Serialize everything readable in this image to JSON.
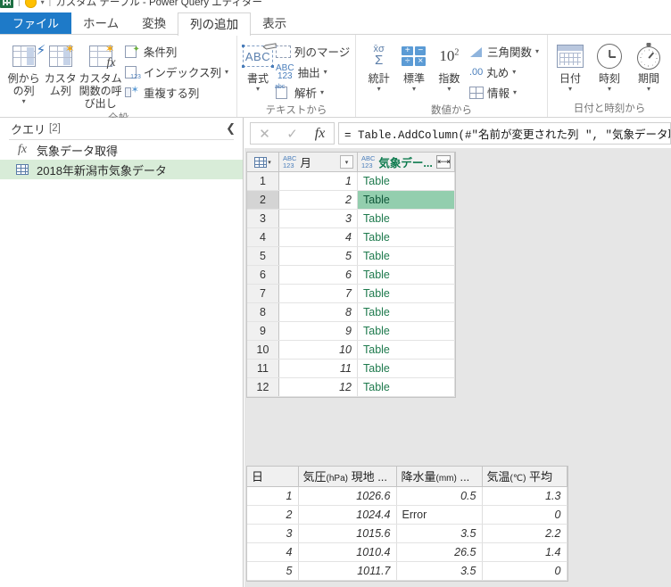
{
  "window": {
    "title": "カスタム テーブル - Power Query エディター",
    "quick_access": [
      "save-icon",
      "undo-icon",
      "redo-icon"
    ]
  },
  "tabs": [
    {
      "label": "ファイル",
      "kind": "file"
    },
    {
      "label": "ホーム",
      "kind": "normal"
    },
    {
      "label": "変換",
      "kind": "normal"
    },
    {
      "label": "列の追加",
      "kind": "active"
    },
    {
      "label": "表示",
      "kind": "normal"
    }
  ],
  "ribbon": {
    "groups": [
      {
        "label": "全般",
        "big": [
          {
            "label": "例からの列",
            "icon": "table-from-example-icon",
            "dropdown": true
          },
          {
            "label": "カスタム列",
            "icon": "table-custom-column-icon",
            "dropdown": false
          },
          {
            "label": "カスタム関数の呼び出し",
            "icon": "table-invoke-function-icon",
            "dropdown": false
          }
        ],
        "small": [
          {
            "label": "条件列",
            "icon": "conditional-column-icon",
            "dropdown": false
          },
          {
            "label": "インデックス列",
            "icon": "index-column-icon",
            "dropdown": true
          },
          {
            "label": "重複する列",
            "icon": "duplicate-column-icon",
            "dropdown": false
          }
        ]
      },
      {
        "label": "テキストから",
        "big": [
          {
            "label": "書式",
            "icon": "format-abc-icon",
            "dropdown": true
          }
        ],
        "small": [
          {
            "label": "列のマージ",
            "icon": "merge-columns-icon",
            "dropdown": false
          },
          {
            "label": "抽出",
            "icon": "extract-icon",
            "dropdown": true
          },
          {
            "label": "解析",
            "icon": "parse-icon",
            "dropdown": true
          }
        ]
      },
      {
        "label": "数値から",
        "big": [
          {
            "label": "統計",
            "icon": "statistics-sigma-icon",
            "dropdown": true
          },
          {
            "label": "標準",
            "icon": "standard-calculator-icon",
            "dropdown": true
          },
          {
            "label": "指数",
            "icon": "exponent-icon",
            "dropdown": true
          }
        ],
        "small": [
          {
            "label": "三角関数",
            "icon": "trigonometry-icon",
            "dropdown": true
          },
          {
            "label": "丸め",
            "icon": "rounding-icon",
            "dropdown": true
          },
          {
            "label": "情報",
            "icon": "information-icon",
            "dropdown": true
          }
        ]
      },
      {
        "label": "日付と時刻から",
        "big": [
          {
            "label": "日付",
            "icon": "calendar-icon",
            "dropdown": true
          },
          {
            "label": "時刻",
            "icon": "clock-icon",
            "dropdown": true
          },
          {
            "label": "期間",
            "icon": "duration-timer-icon",
            "dropdown": true
          }
        ],
        "small": []
      }
    ]
  },
  "queries_pane": {
    "title": "クエリ",
    "count": "[2]",
    "collapse_icon": "chevron-left-icon",
    "items": [
      {
        "label": "気象データ取得",
        "icon": "fx-function-icon",
        "selected": false
      },
      {
        "label": "2018年新潟市気象データ",
        "icon": "table-icon",
        "selected": true
      }
    ]
  },
  "formula_bar": {
    "cancel_icon": "close-icon",
    "confirm_icon": "check-icon",
    "fx_icon": "fx-icon",
    "value": "= Table.AddColumn(#\"名前が変更された列 \", \"気象データ取得\"",
    "placeholder": ""
  },
  "main_grid": {
    "columns": [
      {
        "name": "月",
        "type_badge": "ABC\n123",
        "control": "filter-dropdown",
        "green": false
      },
      {
        "name": "気象デー...",
        "type_badge": "ABC\n123",
        "control": "expand",
        "green": true
      }
    ],
    "rows": [
      {
        "n": "1",
        "month": "1",
        "value": "Table",
        "selected": false
      },
      {
        "n": "2",
        "month": "2",
        "value": "Table",
        "selected": true
      },
      {
        "n": "3",
        "month": "3",
        "value": "Table",
        "selected": false
      },
      {
        "n": "4",
        "month": "4",
        "value": "Table",
        "selected": false
      },
      {
        "n": "5",
        "month": "5",
        "value": "Table",
        "selected": false
      },
      {
        "n": "6",
        "month": "6",
        "value": "Table",
        "selected": false
      },
      {
        "n": "7",
        "month": "7",
        "value": "Table",
        "selected": false
      },
      {
        "n": "8",
        "month": "8",
        "value": "Table",
        "selected": false
      },
      {
        "n": "9",
        "month": "9",
        "value": "Table",
        "selected": false
      },
      {
        "n": "10",
        "month": "10",
        "value": "Table",
        "selected": false
      },
      {
        "n": "11",
        "month": "11",
        "value": "Table",
        "selected": false
      },
      {
        "n": "12",
        "month": "12",
        "value": "Table",
        "selected": false
      }
    ]
  },
  "preview_grid": {
    "columns": [
      "日",
      "気圧(hPa) 現地 ...",
      "降水量(mm) ...",
      "気温(℃) 平均"
    ],
    "rows": [
      {
        "day": "1",
        "pressure": "1026.6",
        "rain": "0.5",
        "temp": "1.3",
        "rain_error": false
      },
      {
        "day": "2",
        "pressure": "1024.4",
        "rain": "Error",
        "temp": "0",
        "rain_error": true
      },
      {
        "day": "3",
        "pressure": "1015.6",
        "rain": "3.5",
        "temp": "2.2",
        "rain_error": false
      },
      {
        "day": "4",
        "pressure": "1010.4",
        "rain": "26.5",
        "temp": "1.4",
        "rain_error": false
      },
      {
        "day": "5",
        "pressure": "1011.7",
        "rain": "3.5",
        "temp": "0",
        "rain_error": false
      }
    ]
  },
  "colors": {
    "file_tab": "#1e7ac8",
    "selection_green": "#93ceae",
    "query_selected": "#d8ecd8",
    "header_gray": "#f0f0f0",
    "canvas_gray": "#e6e6e6",
    "table_link_green": "#1e7a4d"
  }
}
